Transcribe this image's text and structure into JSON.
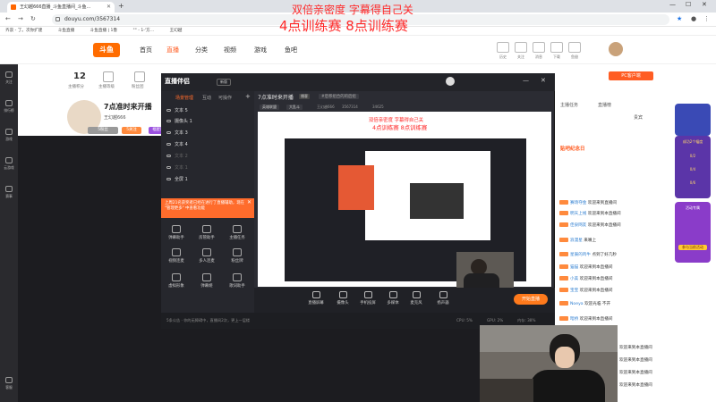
{
  "browser": {
    "tab_title": "王幻越666直播_斗鱼直播间_斗鱼...",
    "url": "douyu.com/3567314",
    "bookmarks": [
      "齐哀 - 丁。次你扩建",
      "斗鱼直播",
      "斗鱼直播 | 1鲁",
      "\"\" - 1-'方...",
      "王幻越"
    ]
  },
  "caption": {
    "line1": "双倍亲密度 字幕得自己关",
    "line2": "4点训练赛 8点训练赛",
    "preview_line1": "双倍亲密度 字幕得自己关",
    "preview_line2": "4点训练赛 8点训练赛"
  },
  "site": {
    "logo": "斗鱼",
    "nav": [
      "首页",
      "直播",
      "分类",
      "视频",
      "游戏",
      "鱼吧"
    ],
    "header_icons": [
      "历史",
      "关注",
      "消息",
      "下载",
      "鱼翅",
      "个人中心"
    ],
    "pc_button": "PC客户端"
  },
  "sidebar": [
    "关注",
    "排行榜",
    "游戏",
    "云游戏",
    "赛事",
    "客服"
  ],
  "room": {
    "rank": "12",
    "rank_label": "主播积分",
    "stat2_label": "主播等级",
    "stat3_label": "粉丝团",
    "title": "7点准时来开播",
    "streamer": "王幻越666",
    "fans_btn": "5粉丝",
    "follow_btn": "5关注",
    "tag": "福星贴吧"
  },
  "obs": {
    "app_name": "直播伴侣",
    "version": "新版",
    "tabs": [
      "场景管理",
      "互动",
      "可操作"
    ],
    "sources": [
      {
        "name": "文本 5",
        "on": true
      },
      {
        "name": "摄像头 1",
        "on": true
      },
      {
        "name": "文本 3",
        "on": true
      },
      {
        "name": "文本 4",
        "on": true
      },
      {
        "name": "文本 2",
        "on": false
      },
      {
        "name": "文本 1",
        "on": false
      },
      {
        "name": "全屏 1",
        "on": true
      }
    ],
    "notice": "上周21名获奖者已经在进行了直播辅助，现在 \"管理更多\" 中查看功能",
    "tools": [
      "弹幕助手",
      "房管助手",
      "主播任务",
      "视频连麦",
      "多人连麦",
      "粉丝牌",
      "虚拟形象",
      "弹幕姬",
      "歌词助手"
    ],
    "stream_title": "7点准时来开播",
    "stream_badge": "播客",
    "stream_tag": "#后移组合的的后组",
    "room_chip": "英雄联盟",
    "game_chip": "大乱斗",
    "stats": [
      "王幻越666",
      "3567314",
      "34625"
    ],
    "bottom": [
      "直播屏幕",
      "摄像头",
      "手机投屏",
      "多媒体",
      "麦克风",
      "扬声器"
    ],
    "start_btn": "开始直播",
    "status": "5条公告 · 你的无障碍中，直播间2次，更上一层楼",
    "perf": [
      "CPU: 5%",
      "GPU: 2%",
      "内存: 38%"
    ]
  },
  "chat": {
    "tabs": [
      "主播任务",
      "直播榜",
      "贵宾"
    ],
    "header": "贴吧纪念日",
    "lines": [
      {
        "name": "赛场夺金",
        "text": "欢迎来到直播间"
      },
      {
        "name": "明天上线",
        "text": "欢迎来到本直播间"
      },
      {
        "name": "佳泉网友",
        "text": "欢迎来到本直播间"
      },
      {
        "name": "浪漫星",
        "text": "来嘴上"
      },
      {
        "name": "星辰的鸡牛",
        "text": "点到了好几秒"
      },
      {
        "name": "猫猫",
        "text": "欢迎来到本直播间"
      },
      {
        "name": "小美",
        "text": "欢迎来到本直播间"
      },
      {
        "name": "宝宝",
        "text": "欢迎来到本直播间"
      },
      {
        "name": "暗桥",
        "text": "欢迎来到本直播间"
      },
      {
        "name": "南鱼",
        "text": "欢迎来到本直播间"
      },
      {
        "name": "Noeya",
        "text": "欢迎光临 不开"
      },
      {
        "name": "小李",
        "text": "欢迎来到本直播间"
      },
      {
        "name": "空影",
        "text": "欢迎来到本直播间"
      },
      {
        "name": "杰",
        "text": "欢迎来到本直播间"
      }
    ]
  },
  "right_ads": [
    "成功2个幅度",
    "0/2",
    "0/4",
    "0/6",
    "活动专属",
    "参与当前活动"
  ],
  "window_controls": [
    "—",
    "☐",
    "✕"
  ]
}
